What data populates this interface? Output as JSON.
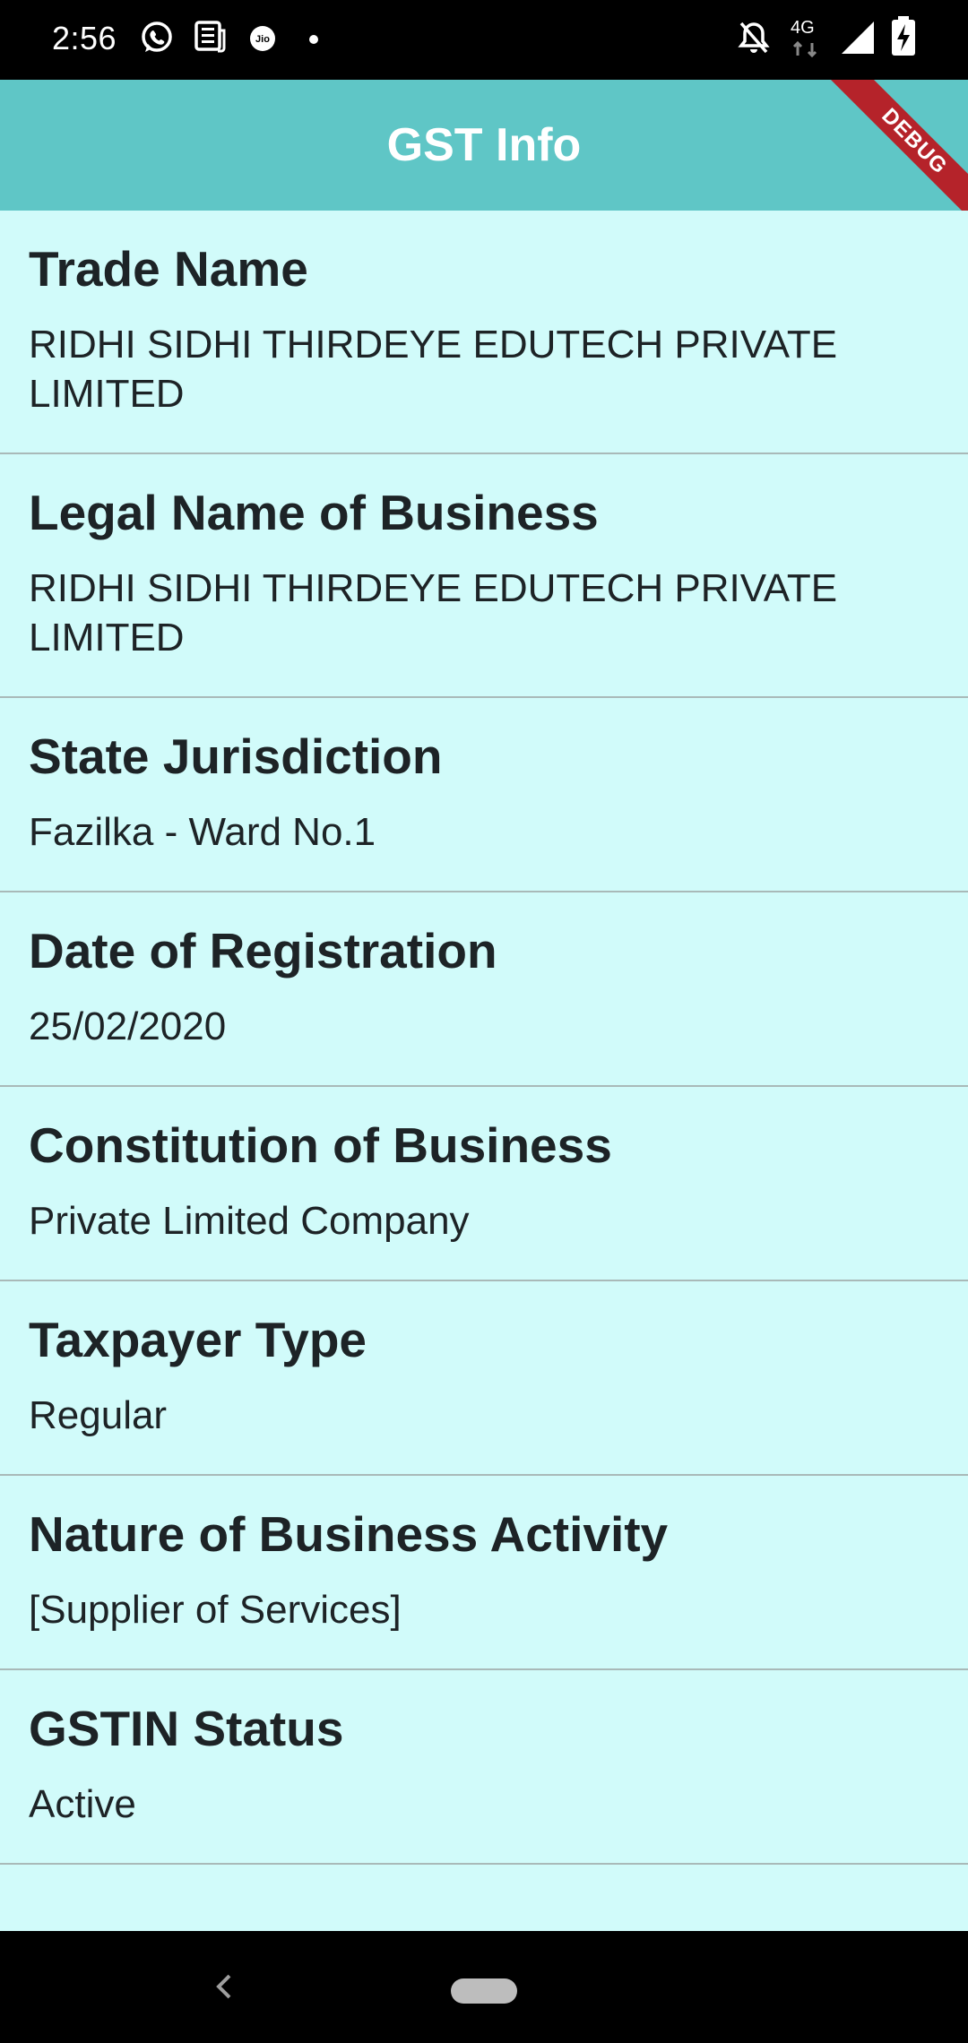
{
  "status_bar": {
    "time": "2:56",
    "icons": [
      "whatsapp-icon",
      "news-icon",
      "jio-icon",
      "dot-icon",
      "notifications-off-icon",
      "network-4g-icon",
      "signal-icon",
      "battery-charging-icon"
    ],
    "network_label": "4G"
  },
  "app_bar": {
    "title": "GST Info",
    "debug_banner": "DEBUG",
    "color": "#5fc6c6",
    "banner_color": "#b5232a"
  },
  "items": [
    {
      "title": "Trade Name",
      "value": "RIDHI SIDHI THIRDEYE EDUTECH PRIVATE LIMITED"
    },
    {
      "title": "Legal Name of Business",
      "value": "RIDHI SIDHI THIRDEYE EDUTECH PRIVATE LIMITED"
    },
    {
      "title": "State Jurisdiction",
      "value": "Fazilka - Ward No.1"
    },
    {
      "title": "Date of Registration",
      "value": "25/02/2020"
    },
    {
      "title": "Constitution of Business",
      "value": "Private Limited Company"
    },
    {
      "title": "Taxpayer Type",
      "value": "Regular"
    },
    {
      "title": "Nature of Business Activity",
      "value": "[Supplier of Services]"
    },
    {
      "title": "GSTIN Status",
      "value": "Active"
    }
  ],
  "nav_bar": {
    "icons": [
      "back-icon",
      "home-pill-icon"
    ]
  },
  "colors": {
    "background": "#d1fbfa",
    "divider": "#a9b9b8",
    "text": "#1d2326"
  }
}
